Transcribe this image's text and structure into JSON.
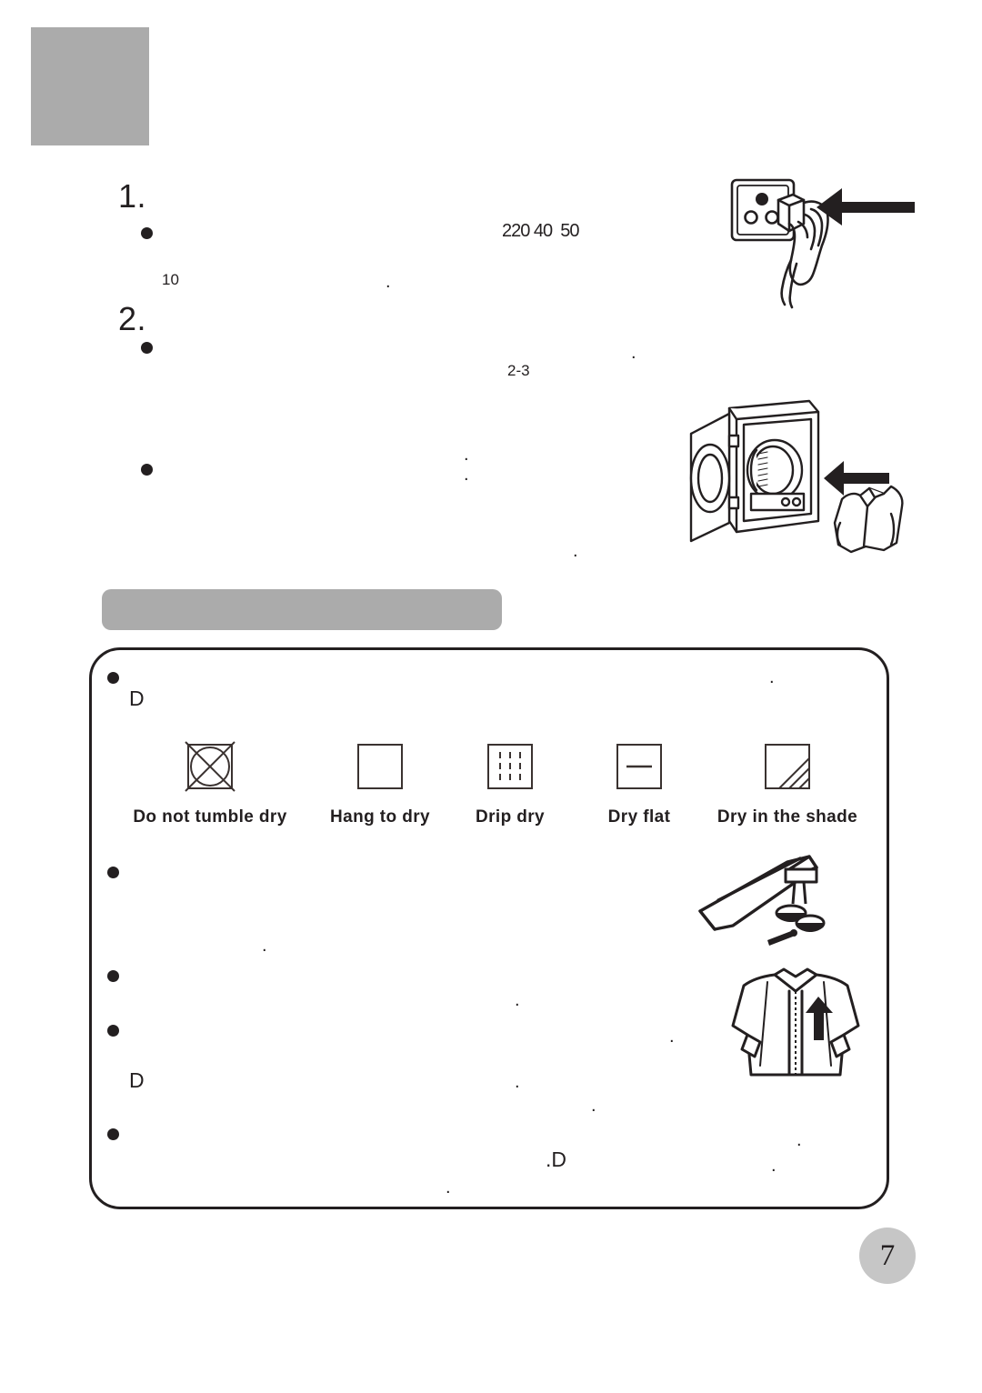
{
  "page": {
    "number": "7",
    "header_block_text": "",
    "section_bar_text": ""
  },
  "steps": [
    {
      "number": "1.",
      "bullets": [
        {
          "marker": "•",
          "fragments": [
            "220",
            "40",
            "50"
          ]
        }
      ],
      "trailing_fragments": [
        "10",
        "."
      ]
    },
    {
      "number": "2.",
      "bullets": [
        {
          "marker": "•",
          "fragments": [
            "2-3",
            "."
          ]
        },
        {
          "marker": "•",
          "fragments": [
            ".",
            ".",
            "."
          ]
        }
      ]
    }
  ],
  "fragments": {
    "voltage_line": "220 40  50",
    "voltage_a": "220",
    "voltage_b": "40",
    "voltage_c": "50",
    "minutes": "10",
    "hours": "2-3",
    "period": ".",
    "letter_d": "D",
    "period_letter_d": ".D"
  },
  "illustrations": {
    "socket": "hand-plugging-power-socket-icon",
    "dryer": "tumble-dryer-loading-laundry-icon",
    "pockets": "empty-pockets-coins-keys-icon",
    "shirt": "zip-up-shirt-before-drying-icon"
  },
  "care_symbols": {
    "items": [
      {
        "label": "Do not tumble dry",
        "icon": "do-not-tumble-dry-symbol"
      },
      {
        "label": "Hang to dry",
        "icon": "hang-to-dry-symbol"
      },
      {
        "label": "Drip dry",
        "icon": "drip-dry-symbol"
      },
      {
        "label": "Dry flat",
        "icon": "dry-flat-symbol"
      },
      {
        "label": "Dry in the shade",
        "icon": "dry-in-the-shade-symbol"
      }
    ]
  },
  "colors": {
    "grey_block": "#ababab",
    "page_badge": "#c6c6c6",
    "ink": "#231f20",
    "symbol_stroke": "#3a3230"
  }
}
